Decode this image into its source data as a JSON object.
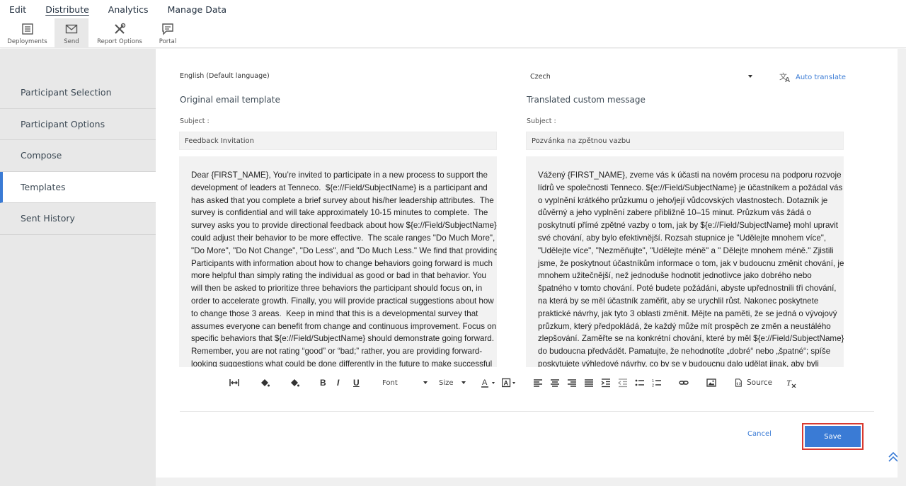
{
  "menu": {
    "items": [
      "Edit",
      "Distribute",
      "Analytics",
      "Manage Data"
    ]
  },
  "ribbon": {
    "deployments": "Deployments",
    "send": "Send",
    "report_options": "Report Options",
    "portal": "Portal"
  },
  "nav": {
    "items": [
      "Participant Selection",
      "Participant Options",
      "Compose",
      "Templates",
      "Sent History"
    ]
  },
  "left": {
    "language": "English (Default language)",
    "heading": "Original email template",
    "subject_label": "Subject :",
    "subject_value": "Feedback Invitation",
    "body_lines": [
      "Dear {FIRST_NAME}, You’re invited to participate in a new process to support the",
      "development of leaders at Tenneco.  ${e://Field/SubjectName} is a participant and",
      "has asked that you complete a brief survey about his/her leadership attributes.  The",
      "survey is confidential and will take approximately 10-15 minutes to complete.  The",
      "survey asks you to provide directional feedback about how ${e://Field/SubjectName}",
      "could adjust their behavior to be more effective.  The scale ranges \"Do Much More\",",
      "\"Do More\", \"Do Not Change\", \"Do Less\", and \"Do Much Less.\" We find that providing",
      "Participants with information about how to change behaviors going forward is much",
      "more helpful than simply rating the individual as good or bad in that behavior. You",
      "will then be asked to prioritize three behaviors the participant should focus on, in",
      "order to accelerate growth. Finally, you will provide practical suggestions about how",
      "to change those 3 areas.  Keep in mind that this is a developmental survey that",
      "assumes everyone can benefit from change and continuous improvement. Focus on",
      "specific behaviors that ${e://Field/SubjectName} should demonstrate going forward.",
      "Remember, you are not rating “good” or “bad;” rather, you are providing forward-",
      "looking suggestions what could be done differently in the future to make successful"
    ]
  },
  "right": {
    "language": "Czech",
    "auto_translate": "Auto translate",
    "heading": "Translated custom message",
    "subject_label": "Subject :",
    "subject_value": "Pozvánka na zpětnou vazbu",
    "body_lines": [
      "Vážený {FIRST_NAME}, zveme vás k účasti na novém procesu na podporu rozvoje",
      "lídrů ve společnosti Tenneco. ${e://Field/SubjectName} je účastníkem a požádal vás",
      "o vyplnění krátkého průzkumu o jeho/její vůdcovských vlastnostech. Dotazník je",
      "důvěrný a jeho vyplnění zabere přibližně 10–15 minut. Průzkum vás žádá o",
      "poskytnutí přímé zpětné vazby o tom, jak by ${e://Field/SubjectName} mohl upravit",
      "své chování, aby bylo efektivnější. Rozsah stupnice je \"Udělejte mnohem více\",",
      "\"Udělejte více\", \"Nezměňujte\", \"Udělejte méně\" a \" Dělejte mnohem méně.\" Zjistili",
      "jsme, že poskytnout účastníkům informace o tom, jak v budoucnu změnit chování, je",
      "mnohem užitečnější, než jednoduše hodnotit jednotlivce jako dobrého nebo",
      "špatného v tomto chování. Poté budete požádáni, abyste upřednostnili tři chování,",
      "na která by se měl účastník zaměřit, aby se urychlil růst. Nakonec poskytnete",
      "praktické návrhy, jak tyto 3 oblasti změnit. Mějte na paměti, že se jedná o vývojový",
      "průzkum, který předpokládá, že každý může mít prospěch ze změn a neustálého",
      "zlepšování. Zaměřte se na konkrétní chování, které by měl ${e://Field/SubjectName}",
      "do budoucna předvádět. Pamatujte, že nehodnotíte „dobré“ nebo „špatné“; spíše",
      "poskytujete výhledové návrhy, co by se v budoucnu dalo udělat jinak, aby byli"
    ]
  },
  "toolbar": {
    "bold": "B",
    "italic": "I",
    "underline": "U",
    "font": "Font",
    "size": "Size",
    "source": "Source"
  },
  "actions": {
    "cancel": "Cancel",
    "save": "Save"
  },
  "colors": {
    "accent": "#3a7bd5",
    "highlight_border": "#d93a30",
    "nav_bg": "#e8e8e8"
  }
}
